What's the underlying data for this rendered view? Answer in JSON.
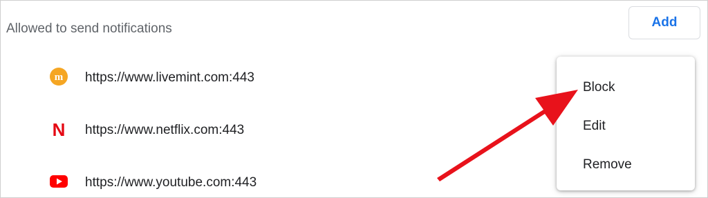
{
  "section": {
    "title": "Allowed to send notifications"
  },
  "toolbar": {
    "add_label": "Add"
  },
  "sites": [
    {
      "url": "https://www.livemint.com:443",
      "icon": "livemint-icon",
      "icon_letter": "m"
    },
    {
      "url": "https://www.netflix.com:443",
      "icon": "netflix-icon",
      "icon_letter": "N"
    },
    {
      "url": "https://www.youtube.com:443",
      "icon": "youtube-icon"
    }
  ],
  "menu": {
    "items": [
      {
        "label": "Block"
      },
      {
        "label": "Edit"
      },
      {
        "label": "Remove"
      }
    ]
  },
  "colors": {
    "accent": "#1a73e8",
    "arrow": "#e8121b",
    "livemint": "#f5a623",
    "netflix": "#e50914",
    "youtube": "#ff0000"
  }
}
